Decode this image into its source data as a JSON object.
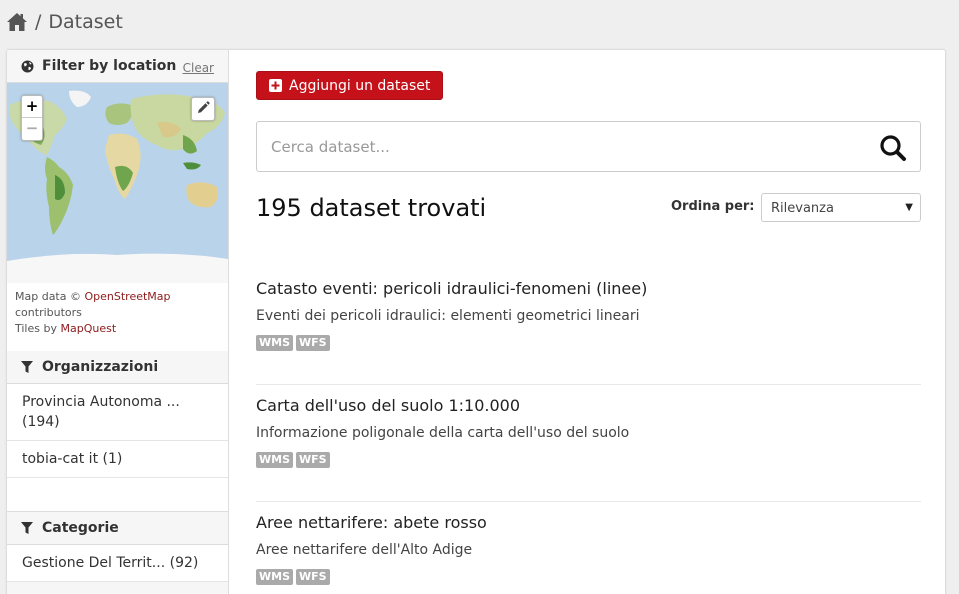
{
  "breadcrumb": {
    "separator": "/",
    "current": "Dataset"
  },
  "sidebar": {
    "location": {
      "heading": "Filter by location",
      "clear_label": "Clear",
      "zoom_in": "+",
      "zoom_out": "−",
      "attribution": {
        "prefix": "Map data ©",
        "osm_link": "OpenStreetMap",
        "contributors": "contributors",
        "tiles_prefix": "Tiles by",
        "tiles_link": "MapQuest"
      }
    },
    "organizations": {
      "heading": "Organizzazioni",
      "items": [
        {
          "label": "Provincia Autonoma ...",
          "count": "(194)"
        },
        {
          "label": "tobia-cat it",
          "count": "(1)"
        }
      ]
    },
    "categories": {
      "heading": "Categorie",
      "items": [
        {
          "label": "Gestione Del Territ...",
          "count": "(92)"
        }
      ]
    }
  },
  "main": {
    "add_button": "Aggiungi un dataset",
    "search": {
      "placeholder": "Cerca dataset...",
      "value": ""
    },
    "results_count": "195 dataset trovati",
    "sort": {
      "label": "Ordina per:",
      "selected": "Rilevanza"
    },
    "datasets": [
      {
        "title": "Catasto eventi: pericoli idraulici-fenomeni (linee)",
        "description": "Eventi dei pericoli idraulici: elementi geometrici lineari",
        "formats": [
          "WMS",
          "WFS"
        ]
      },
      {
        "title": "Carta dell'uso del suolo 1:10.000",
        "description": "Informazione poligonale della carta dell'uso del suolo",
        "formats": [
          "WMS",
          "WFS"
        ]
      },
      {
        "title": "Aree nettarifere: abete rosso",
        "description": "Aree nettarifere dell'Alto Adige",
        "formats": [
          "WMS",
          "WFS"
        ]
      }
    ]
  },
  "colors": {
    "accent": "#c5121a",
    "badge": "#aaaaaa",
    "link": "#8b1a1a"
  }
}
